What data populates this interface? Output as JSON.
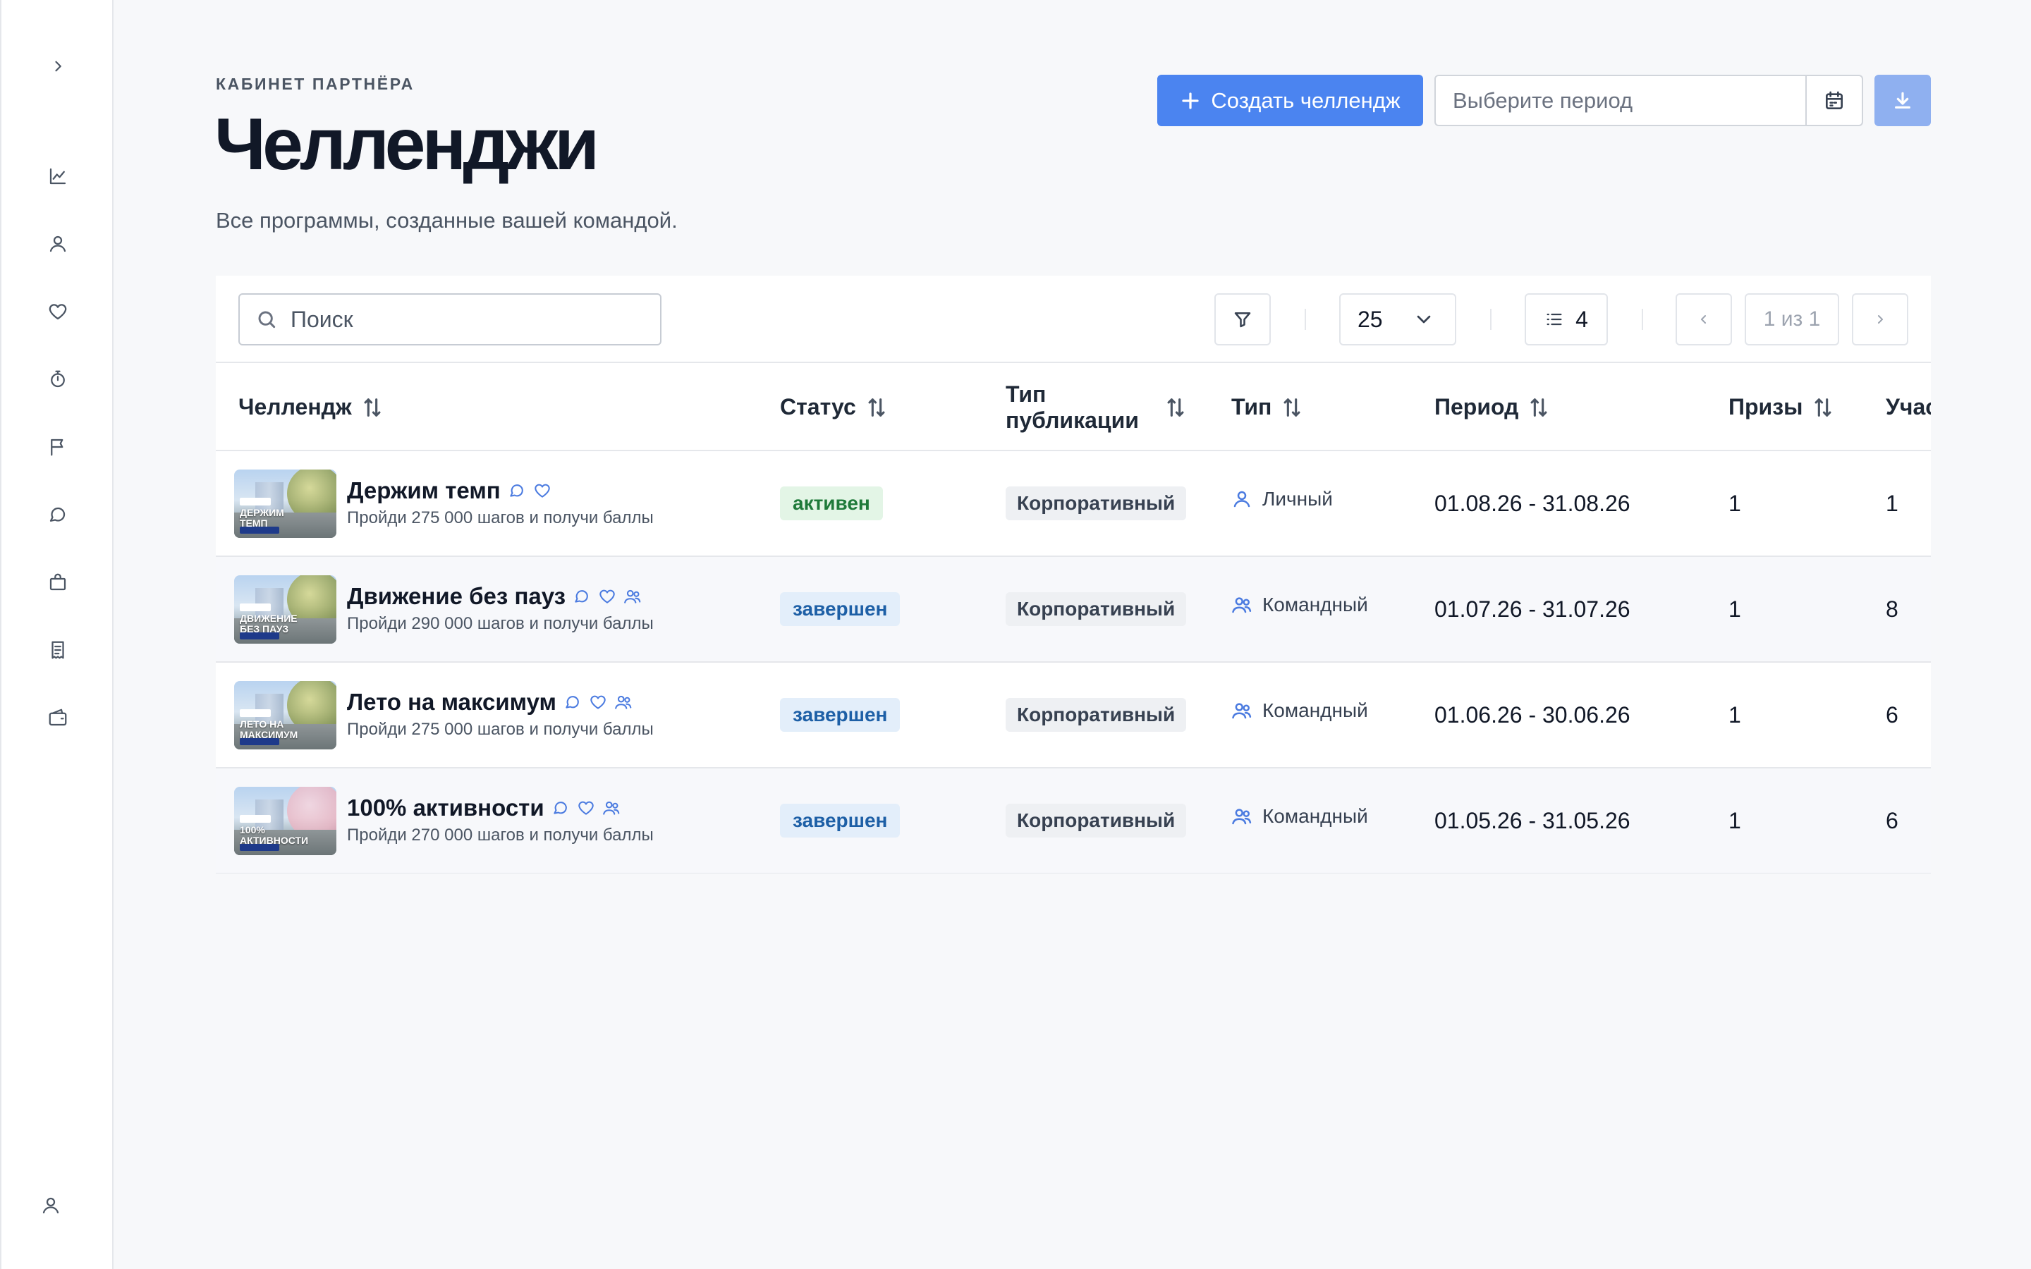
{
  "sidebar": {
    "icons": [
      "chevron-right-icon",
      "chart-icon",
      "user-icon",
      "heart-icon",
      "stopwatch-icon",
      "flag-icon",
      "chat-icon",
      "shopping-bag-icon",
      "receipt-icon",
      "wallet-icon",
      "profile-icon"
    ]
  },
  "header": {
    "eyebrow": "КАБИНЕТ ПАРТНЁРА",
    "title": "Челленджи",
    "subtitle": "Все программы, созданные вашей командой.",
    "create_label": "Создать челлендж",
    "period_placeholder": "Выберите период"
  },
  "toolbar": {
    "search_placeholder": "Поиск",
    "page_size": "25",
    "columns_count": "4",
    "page_info": "1 из 1"
  },
  "table": {
    "columns": {
      "challenge": "Челлендж",
      "status": "Статус",
      "pub_type": "Тип публикации",
      "type": "Тип",
      "period": "Период",
      "prizes": "Призы",
      "participants": "Учас"
    },
    "rows": [
      {
        "name": "Держим темп",
        "desc": "Пройди 275 000 шагов и получи баллы",
        "thumb_text": "ДЕРЖИМ ТЕМП",
        "status": "активен",
        "pub_type": "Корпоративный",
        "type": "Личный",
        "period": "01.08.26 - 31.08.26",
        "prizes": "1",
        "participants": "1"
      },
      {
        "name": "Движение без пауз",
        "desc": "Пройди 290 000 шагов и получи баллы",
        "thumb_text": "ДВИЖЕНИЕ БЕЗ ПАУЗ",
        "status": "завершен",
        "pub_type": "Корпоративный",
        "type": "Командный",
        "period": "01.07.26 - 31.07.26",
        "prizes": "1",
        "participants": "8"
      },
      {
        "name": "Лето на максимум",
        "desc": "Пройди 275 000 шагов и получи баллы",
        "thumb_text": "ЛЕТО НА МАКСИМУМ",
        "status": "завершен",
        "pub_type": "Корпоративный",
        "type": "Командный",
        "period": "01.06.26 - 30.06.26",
        "prizes": "1",
        "participants": "6"
      },
      {
        "name": "100% активности",
        "desc": "Пройди 270 000 шагов и получи баллы",
        "thumb_text": "100% АКТИВНОСТИ",
        "status": "завершен",
        "pub_type": "Корпоративный",
        "type": "Командный",
        "period": "01.05.26 - 31.05.26",
        "prizes": "1",
        "participants": "6"
      }
    ]
  },
  "colors": {
    "accent": "#4b84f0",
    "accent_light": "#8fb0f0",
    "status_active_bg": "#e3f5e6",
    "status_active_fg": "#1f7a3a",
    "status_done_bg": "#e3eefa",
    "status_done_fg": "#1d5fa6",
    "icon_blue": "#4b7be0"
  }
}
